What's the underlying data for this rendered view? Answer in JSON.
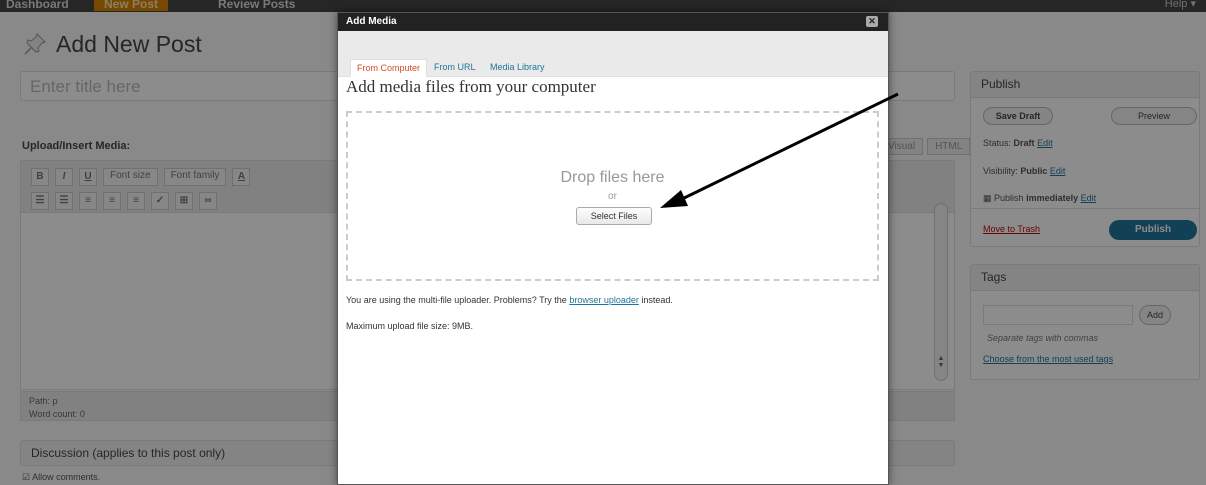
{
  "topbar": {
    "items": [
      "Dashboard",
      "New Post",
      "Review Posts"
    ],
    "help": "Help ▾"
  },
  "page": {
    "title": "Add New Post",
    "title_placeholder": "Enter title here",
    "upload_label": "Upload/Insert Media:",
    "editor_tabs": [
      "Visual",
      "HTML"
    ],
    "toolbar_row1": [
      "B",
      "I",
      "U",
      "Font size",
      "Font family",
      "A"
    ],
    "path": "Path: p",
    "word_count": "Word count: 0",
    "discussion": "Discussion (applies to this post only)",
    "allow_comments": "Allow comments."
  },
  "publish": {
    "title": "Publish",
    "save_draft": "Save Draft",
    "preview": "Preview",
    "status_label": "Status:",
    "status_value": "Draft",
    "visibility_label": "Visibility:",
    "visibility_value": "Public",
    "schedule_label": "Publish",
    "schedule_value": "immediately",
    "edit": "Edit",
    "trash": "Move to Trash",
    "publish_button": "Publish"
  },
  "tags": {
    "title": "Tags",
    "add": "Add",
    "hint": "Separate tags with commas",
    "choose": "Choose from the most used tags"
  },
  "modal": {
    "title": "Add Media",
    "close": "✕",
    "tabs": [
      "From Computer",
      "From URL",
      "Media Library"
    ],
    "active_tab": "From Computer",
    "heading": "Add media files from your computer",
    "drop_text": "Drop files here",
    "or": "or",
    "select_files": "Select Files",
    "info_prefix": "You are using the multi-file uploader. Problems? Try the",
    "info_link": "browser uploader",
    "info_suffix": "instead.",
    "max_size": "Maximum upload file size: 9MB."
  },
  "colors": {
    "admin_bar": "#464646",
    "link": "#21759b",
    "active_tab": "#d54e21",
    "publish_button": "#21759b"
  }
}
